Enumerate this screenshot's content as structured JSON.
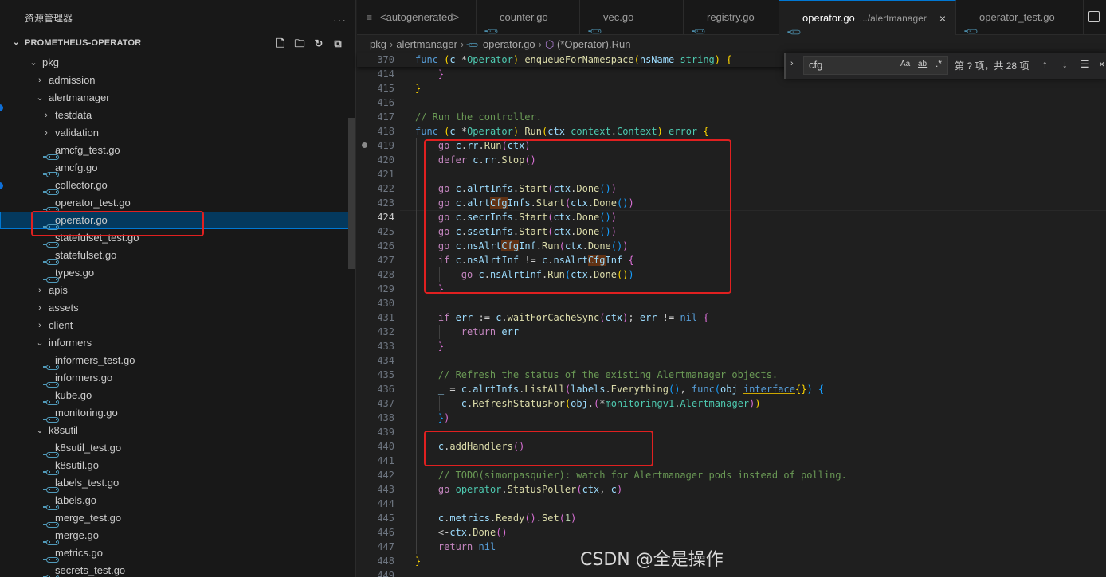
{
  "sidebar": {
    "title": "资源管理器",
    "more": "···",
    "project": "PROMETHEUS-OPERATOR",
    "tree": [
      {
        "label": "pkg",
        "type": "folder",
        "open": true,
        "depth": 0
      },
      {
        "label": "admission",
        "type": "folder",
        "open": false,
        "depth": 1
      },
      {
        "label": "alertmanager",
        "type": "folder",
        "open": true,
        "depth": 1
      },
      {
        "label": "testdata",
        "type": "folder",
        "open": false,
        "depth": 2
      },
      {
        "label": "validation",
        "type": "folder",
        "open": false,
        "depth": 2
      },
      {
        "label": "amcfg_test.go",
        "type": "go",
        "depth": 2
      },
      {
        "label": "amcfg.go",
        "type": "go",
        "depth": 2
      },
      {
        "label": "collector.go",
        "type": "go",
        "depth": 2
      },
      {
        "label": "operator_test.go",
        "type": "go",
        "depth": 2
      },
      {
        "label": "operator.go",
        "type": "go",
        "depth": 2,
        "selected": true
      },
      {
        "label": "statefulset_test.go",
        "type": "go",
        "depth": 2
      },
      {
        "label": "statefulset.go",
        "type": "go",
        "depth": 2
      },
      {
        "label": "types.go",
        "type": "go",
        "depth": 2
      },
      {
        "label": "apis",
        "type": "folder",
        "open": false,
        "depth": 1
      },
      {
        "label": "assets",
        "type": "folder",
        "open": false,
        "depth": 1
      },
      {
        "label": "client",
        "type": "folder",
        "open": false,
        "depth": 1
      },
      {
        "label": "informers",
        "type": "folder",
        "open": true,
        "depth": 1
      },
      {
        "label": "informers_test.go",
        "type": "go",
        "depth": 2
      },
      {
        "label": "informers.go",
        "type": "go",
        "depth": 2
      },
      {
        "label": "kube.go",
        "type": "go",
        "depth": 2
      },
      {
        "label": "monitoring.go",
        "type": "go",
        "depth": 2
      },
      {
        "label": "k8sutil",
        "type": "folder",
        "open": true,
        "depth": 1
      },
      {
        "label": "k8sutil_test.go",
        "type": "go",
        "depth": 2
      },
      {
        "label": "k8sutil.go",
        "type": "go",
        "depth": 2
      },
      {
        "label": "labels_test.go",
        "type": "go",
        "depth": 2
      },
      {
        "label": "labels.go",
        "type": "go",
        "depth": 2
      },
      {
        "label": "merge_test.go",
        "type": "go",
        "depth": 2
      },
      {
        "label": "merge.go",
        "type": "go",
        "depth": 2
      },
      {
        "label": "metrics.go",
        "type": "go",
        "depth": 2
      },
      {
        "label": "secrets_test.go",
        "type": "go",
        "depth": 2
      }
    ]
  },
  "tabs": [
    {
      "label": "<autogenerated>",
      "icon": "list-icon"
    },
    {
      "label": "counter.go",
      "icon": "go-file-icon"
    },
    {
      "label": "vec.go",
      "icon": "go-file-icon"
    },
    {
      "label": "registry.go",
      "icon": "go-file-icon"
    },
    {
      "label": "operator.go",
      "desc": ".../alertmanager",
      "icon": "go-file-icon",
      "active": true,
      "close": "×"
    },
    {
      "label": "operator_test.go",
      "icon": "go-file-icon"
    }
  ],
  "breadcrumb": [
    "pkg",
    "alertmanager",
    "operator.go",
    "(*Operator).Run"
  ],
  "find": {
    "query": "cfg",
    "match_case": "Aa",
    "whole_word": "ab",
    "regex": ".*",
    "result": "第 ? 项，共 28 项"
  },
  "watermark": "CSDN @全是操作",
  "code": {
    "sticky": {
      "n": "370",
      "html": "<span class='kw'>func</span> <span class='br1'>(</span><span class='var'>c</span> *<span class='ty'>Operator</span><span class='br1'>)</span> <span class='fn'>enqueueForNamespace</span><span class='br1'>(</span><span class='var'>nsName</span> <span class='ty'>string</span><span class='br1'>)</span> <span class='br1'>{</span>"
    },
    "lines": [
      {
        "n": "414",
        "html": "    <span class='br2'>}</span>"
      },
      {
        "n": "415",
        "html": "<span class='br1'>}</span>"
      },
      {
        "n": "416",
        "html": ""
      },
      {
        "n": "417",
        "html": "<span class='cm'>// Run the controller.</span>"
      },
      {
        "n": "418",
        "html": "<span class='kw'>func</span> <span class='br1'>(</span><span class='var'>c</span> *<span class='ty'>Operator</span><span class='br1'>)</span> <span class='fn'>Run</span><span class='br1'>(</span><span class='var'>ctx</span> <span class='ty'>context</span>.<span class='ty'>Context</span><span class='br1'>)</span> <span class='ty'>error</span> <span class='br1'>{</span>"
      },
      {
        "n": "419",
        "html": "    <span class='kc'>go</span> <span class='var'>c</span>.<span class='var'>rr</span>.<span class='fn'>Run</span><span class='br2'>(</span><span class='var'>ctx</span><span class='br2'>)</span>",
        "dot": true
      },
      {
        "n": "420",
        "html": "    <span class='kc'>defer</span> <span class='var'>c</span>.<span class='var'>rr</span>.<span class='fn'>Stop</span><span class='br2'>()</span>"
      },
      {
        "n": "421",
        "html": ""
      },
      {
        "n": "422",
        "html": "    <span class='kc'>go</span> <span class='var'>c</span>.<span class='var'>alrtInfs</span>.<span class='fn'>Start</span><span class='br2'>(</span><span class='var'>ctx</span>.<span class='fn'>Done</span><span class='br3'>()</span><span class='br2'>)</span>"
      },
      {
        "n": "423",
        "html": "    <span class='kc'>go</span> <span class='var'>c</span>.<span class='var'>alrt<span class='hl'>Cfg</span>Infs</span>.<span class='fn'>Start</span><span class='br2'>(</span><span class='var'>ctx</span>.<span class='fn'>Done</span><span class='br3'>()</span><span class='br2'>)</span>"
      },
      {
        "n": "424",
        "html": "    <span class='kc'>go</span> <span class='var'>c</span>.<span class='var'>secrInfs</span>.<span class='fn'>Start</span><span class='br2'>(</span><span class='var'>ctx</span>.<span class='fn'>Done</span><span class='br3'>()</span><span class='br2'>)</span>",
        "current": true
      },
      {
        "n": "425",
        "html": "    <span class='kc'>go</span> <span class='var'>c</span>.<span class='var'>ssetInfs</span>.<span class='fn'>Start</span><span class='br2'>(</span><span class='var'>ctx</span>.<span class='fn'>Done</span><span class='br3'>()</span><span class='br2'>)</span>"
      },
      {
        "n": "426",
        "html": "    <span class='kc'>go</span> <span class='var'>c</span>.<span class='var'>nsAlrt<span class='hl'>Cfg</span>Inf</span>.<span class='fn'>Run</span><span class='br2'>(</span><span class='var'>ctx</span>.<span class='fn'>Done</span><span class='br3'>()</span><span class='br2'>)</span>"
      },
      {
        "n": "427",
        "html": "    <span class='kc'>if</span> <span class='var'>c</span>.<span class='var'>nsAlrtInf</span> != <span class='var'>c</span>.<span class='var'>nsAlrt<span class='hl'>Cfg</span>Inf</span> <span class='br2'>{</span>"
      },
      {
        "n": "428",
        "html": "        <span class='kc'>go</span> <span class='var'>c</span>.<span class='var'>nsAlrtInf</span>.<span class='fn'>Run</span><span class='br3'>(</span><span class='var'>ctx</span>.<span class='fn'>Done</span><span class='br1'>()</span><span class='br3'>)</span>"
      },
      {
        "n": "429",
        "html": "    <span class='br2'>}</span>"
      },
      {
        "n": "430",
        "html": ""
      },
      {
        "n": "431",
        "html": "    <span class='kc'>if</span> <span class='var'>err</span> := <span class='var'>c</span>.<span class='fn'>waitForCacheSync</span><span class='br2'>(</span><span class='var'>ctx</span><span class='br2'>)</span>; <span class='var'>err</span> != <span class='kw'>nil</span> <span class='br2'>{</span>"
      },
      {
        "n": "432",
        "html": "        <span class='kc'>return</span> <span class='var'>err</span>"
      },
      {
        "n": "433",
        "html": "    <span class='br2'>}</span>"
      },
      {
        "n": "434",
        "html": ""
      },
      {
        "n": "435",
        "html": "    <span class='cm'>// Refresh the status of the existing Alertmanager objects.</span>"
      },
      {
        "n": "436",
        "html": "    <span class='var'>_</span> = <span class='var'>c</span>.<span class='var'>alrtInfs</span>.<span class='fn'>ListAll</span><span class='br2'>(</span><span class='var'>labels</span>.<span class='fn'>Everything</span><span class='br3'>()</span>, <span class='kw'>func</span><span class='br3'>(</span><span class='var'>obj</span> <span class='kw ul'>interface</span><span class='br1'>{}</span><span class='br3'>)</span> <span class='br3'>{</span>"
      },
      {
        "n": "437",
        "html": "        <span class='var'>c</span>.<span class='fn'>RefreshStatusFor</span><span class='br1'>(</span><span class='var'>obj</span>.<span class='br2'>(</span>*<span class='ty'>monitoringv1</span>.<span class='ty'>Alertmanager</span><span class='br2'>)</span><span class='br1'>)</span>"
      },
      {
        "n": "438",
        "html": "    <span class='br3'>}</span><span class='br2'>)</span>"
      },
      {
        "n": "439",
        "html": ""
      },
      {
        "n": "440",
        "html": "    <span class='var'>c</span>.<span class='fn'>addHandlers</span><span class='br2'>()</span>"
      },
      {
        "n": "441",
        "html": ""
      },
      {
        "n": "442",
        "html": "    <span class='cm'>// TODO(simonpasquier): watch for Alertmanager pods instead of polling.</span>"
      },
      {
        "n": "443",
        "html": "    <span class='kc'>go</span> <span class='ty'>operator</span>.<span class='fn'>StatusPoller</span><span class='br2'>(</span><span class='var'>ctx</span>, <span class='var'>c</span><span class='br2'>)</span>"
      },
      {
        "n": "444",
        "html": ""
      },
      {
        "n": "445",
        "html": "    <span class='var'>c</span>.<span class='var'>metrics</span>.<span class='fn'>Ready</span><span class='br2'>()</span>.<span class='fn'>Set</span><span class='br2'>(</span><span class='num'>1</span><span class='br2'>)</span>"
      },
      {
        "n": "446",
        "html": "    &lt;-<span class='var'>ctx</span>.<span class='fn'>Done</span><span class='br2'>()</span>"
      },
      {
        "n": "447",
        "html": "    <span class='kc'>return</span> <span class='kw'>nil</span>"
      },
      {
        "n": "448",
        "html": "<span class='br1'>}</span>"
      },
      {
        "n": "449",
        "html": ""
      }
    ]
  }
}
